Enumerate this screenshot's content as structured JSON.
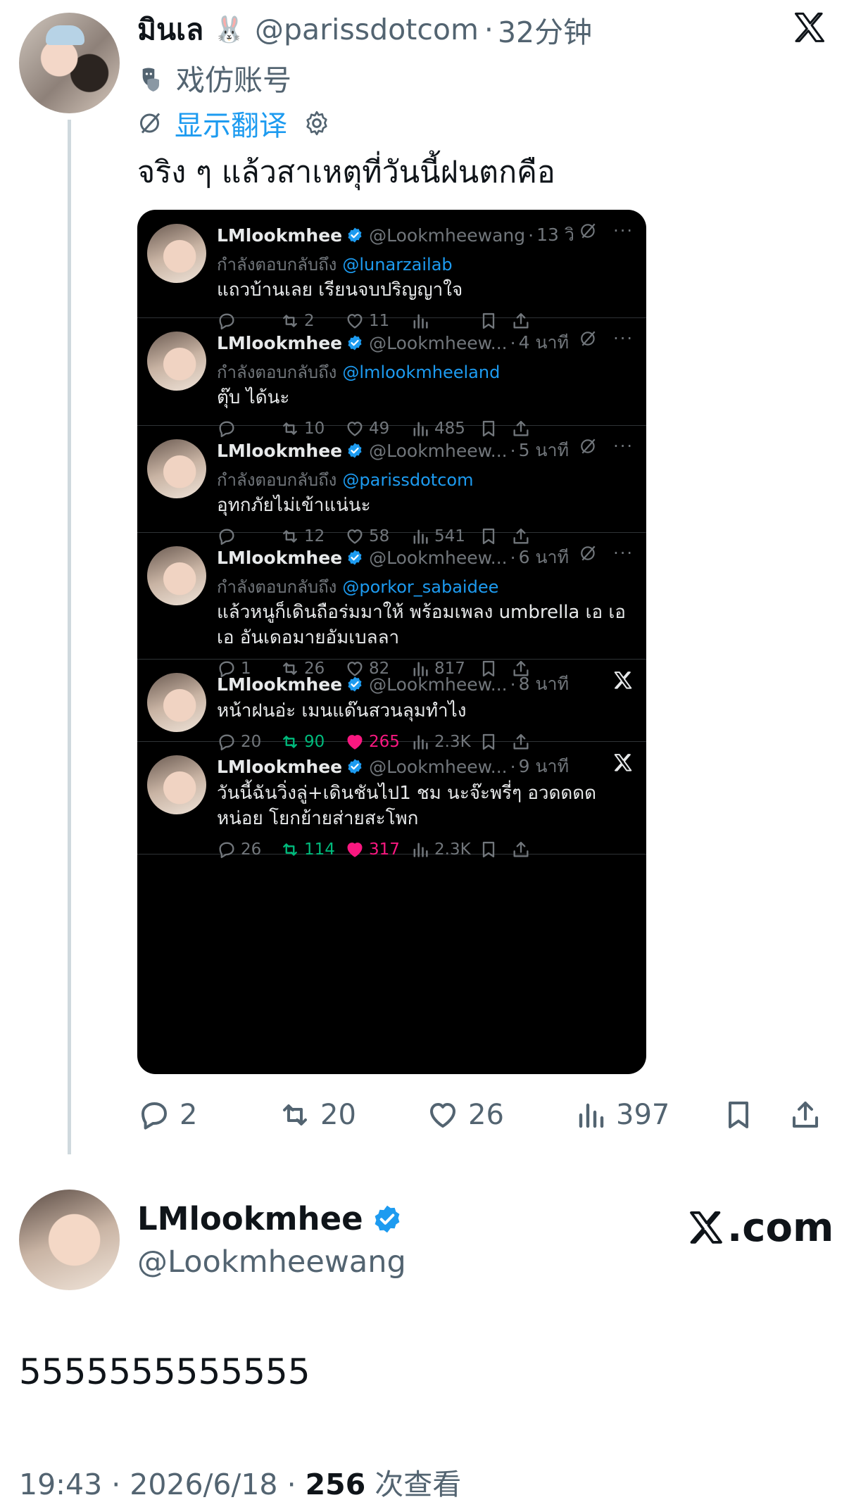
{
  "parent": {
    "name": "มินเล",
    "emoji": "🐰",
    "handle": "@parissdotcom",
    "time": "32分钟",
    "parody_label": "戏仿账号",
    "translate_label": "显示翻译",
    "text": "จริง ๆ แล้วสาเหตุที่วันนี้ฝนตกคือ",
    "stats": {
      "replies": "2",
      "retweets": "20",
      "likes": "26",
      "views": "397"
    }
  },
  "embedded_tweets": [
    {
      "name": "LMlookmhee",
      "handle": "@Lookmheewang",
      "time": "13 วิ",
      "reply_prefix": "กำลังตอบกลับถึง",
      "reply_to": "@lunarzailab",
      "text": "แถวบ้านเลย เรียนจบปริญญาใจ",
      "replies": "",
      "retweets": "2",
      "likes": "11",
      "views": "",
      "liked": false,
      "retweeted": false,
      "icon": "grok"
    },
    {
      "name": "LMlookmhee",
      "handle": "@Lookmheew...",
      "time": "4 นาที",
      "reply_prefix": "กำลังตอบกลับถึง",
      "reply_to": "@lmlookmheeland",
      "text": "ตุ๊บ ได้นะ",
      "replies": "",
      "retweets": "10",
      "likes": "49",
      "views": "485",
      "liked": false,
      "retweeted": false,
      "icon": "grok"
    },
    {
      "name": "LMlookmhee",
      "handle": "@Lookmheew...",
      "time": "5 นาที",
      "reply_prefix": "กำลังตอบกลับถึง",
      "reply_to": "@parissdotcom",
      "text": "อุทกภัยไม่เข้าแน่นะ",
      "replies": "",
      "retweets": "12",
      "likes": "58",
      "views": "541",
      "liked": false,
      "retweeted": false,
      "icon": "grok"
    },
    {
      "name": "LMlookmhee",
      "handle": "@Lookmheew...",
      "time": "6 นาที",
      "reply_prefix": "กำลังตอบกลับถึง",
      "reply_to": "@porkor_sabaidee",
      "text": "แล้วหนูก็เดินถือร่มมาให้ พร้อมเพลง umbrella เอ เอ เอ อันเดอมายอัมเบลลา",
      "replies": "1",
      "retweets": "26",
      "likes": "82",
      "views": "817",
      "liked": false,
      "retweeted": false,
      "icon": "grok"
    },
    {
      "name": "LMlookmhee",
      "handle": "@Lookmheew...",
      "time": "8 นาที",
      "reply_prefix": "",
      "reply_to": "",
      "text": "หน้าฝนอ่ะ เมนแด๊นสวนลุมทำไง",
      "replies": "20",
      "retweets": "90",
      "likes": "265",
      "views": "2.3K",
      "liked": true,
      "retweeted": true,
      "icon": "x"
    },
    {
      "name": "LMlookmhee",
      "handle": "@Lookmheew...",
      "time": "9 นาที",
      "reply_prefix": "",
      "reply_to": "",
      "text": "วันนี้ฉันวิ่งลู่+เดินชันไป1 ชม นะจ๊ะพรี่ๆ อวดดดดหน่อย โยกย้ายส่ายสะโพก",
      "replies": "26",
      "retweets": "114",
      "likes": "317",
      "views": "2.3K",
      "liked": true,
      "retweeted": true,
      "icon": "x"
    }
  ],
  "quoted": {
    "name": "LMlookmhee",
    "handle": "@Lookmheewang",
    "site": ".com",
    "text": "5555555555555",
    "time": "19:43",
    "date": "2026/6/18",
    "views": "256",
    "views_label": "次查看"
  },
  "colors": {
    "link": "#1d9bf0",
    "like": "#f91880",
    "retweet": "#00ba7c",
    "verified": "#1d9bf0"
  }
}
